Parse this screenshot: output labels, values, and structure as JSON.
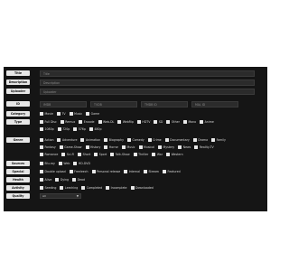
{
  "form": {
    "labels": {
      "title": "Title",
      "description": "Description",
      "uploader": "Uploader",
      "id": "ID",
      "category": "Category",
      "type": "Type",
      "genre": "Genre",
      "sources": "Sources",
      "special": "Special",
      "health": "Health",
      "activity": "Activity",
      "quality": "Quality"
    },
    "placeholders": {
      "title": "Title",
      "description": "Description",
      "uploader": "Uploader",
      "id_1": "IMDB",
      "id_2": "TVDB",
      "id_3": "TMDB ID",
      "id_4": "MAL ID"
    },
    "category_options": [
      "Movie",
      "TV",
      "Music",
      "Game"
    ],
    "type_options_row1": [
      "Full Disc",
      "Remux",
      "Encode",
      "Web-DL",
      "WebRip",
      "HDTV",
      "SD",
      "Other",
      "Mono",
      "Anime"
    ],
    "type_options_row2": [
      "1080p",
      "720p",
      "576p",
      "480p"
    ],
    "genre_rows": [
      [
        "Action",
        "Adventure",
        "Animation",
        "Biography",
        "Comedy",
        "Crime",
        "Documentary",
        "Drama",
        "Family"
      ],
      [
        "Fantasy",
        "Game-Show",
        "History",
        "Horror",
        "Music",
        "Musical",
        "Mystery",
        "News",
        "Reality-TV"
      ],
      [
        "Romance",
        "Sci-Fi",
        "Short",
        "Sport",
        "Talk-Show",
        "Thriller",
        "War",
        "Western"
      ]
    ],
    "sources_options": [
      "Blu-ray",
      "Web",
      "HD-DVD"
    ],
    "special_options": [
      "Double upload",
      "Freeleech",
      "Personal release",
      "Internal",
      "Stream",
      "Featured"
    ],
    "health_options": [
      "Alive",
      "Dying",
      "Dead"
    ],
    "activity_options": [
      "Seeding",
      "Leeching",
      "Completed",
      "Incomplete",
      "Downloaded"
    ],
    "quality_value": "All"
  }
}
